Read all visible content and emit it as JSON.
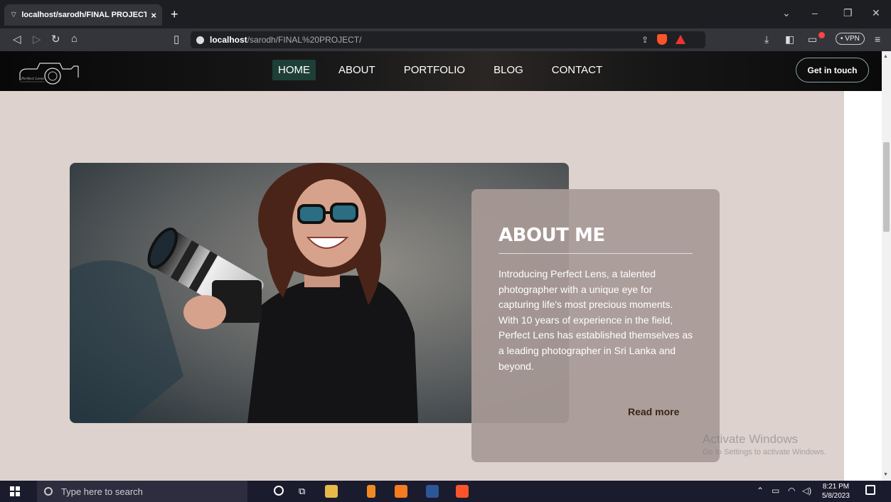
{
  "browser": {
    "tab_title": "localhost/sarodh/FINAL PROJECT",
    "tab_close": "×",
    "new_tab": "+",
    "url_host": "localhost",
    "url_path": "/sarodh/FINAL%20PROJECT/",
    "vpn_label": "• VPN"
  },
  "site": {
    "nav": {
      "items": [
        {
          "label": "HOME",
          "active": true
        },
        {
          "label": "ABOUT",
          "active": false
        },
        {
          "label": "PORTFOLIO",
          "active": false
        },
        {
          "label": "BLOG",
          "active": false
        },
        {
          "label": "CONTACT",
          "active": false
        }
      ],
      "cta": "Get in touch"
    },
    "about": {
      "title": "ABOUT ME",
      "body": "Introducing Perfect Lens, a talented photographer with a unique eye for capturing life's most precious moments. With 10 years of experience in the field, Perfect Lens has established themselves as a leading photographer in Sri Lanka and beyond.",
      "read_more": "Read more"
    }
  },
  "watermark": {
    "line1": "Activate Windows",
    "line2": "Go to Settings to activate Windows."
  },
  "taskbar": {
    "search_placeholder": "Type here to search",
    "time": "8:21 PM",
    "date": "5/8/2023"
  },
  "colors": {
    "page_bg": "#ddd2cd",
    "card_bg": "#a89a96",
    "nav_active": "#1e3f36",
    "read_more": "#3b2416"
  }
}
